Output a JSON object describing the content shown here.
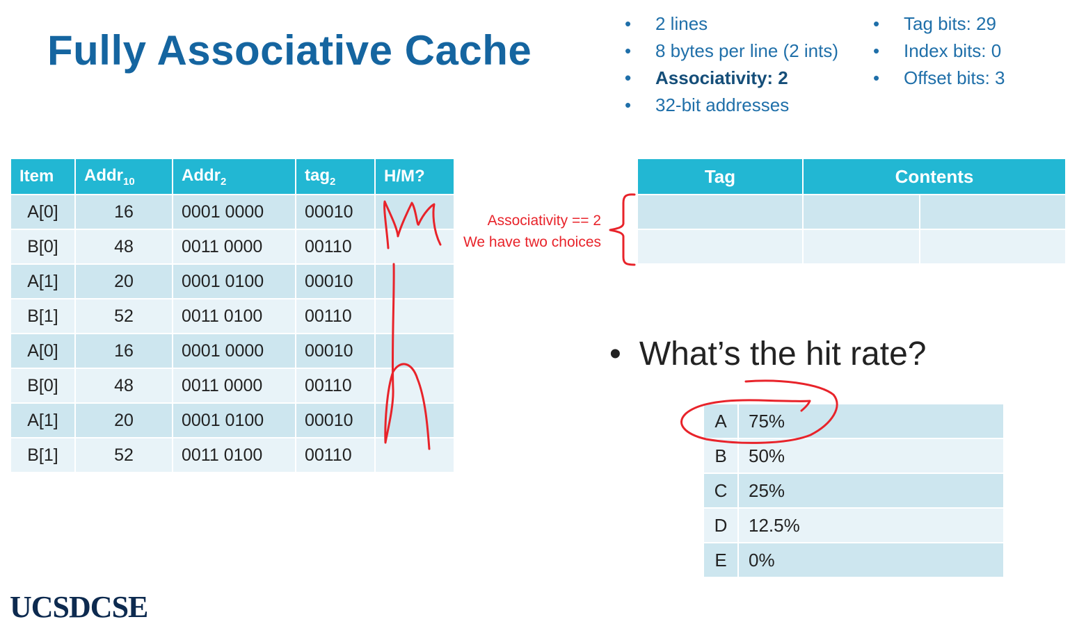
{
  "slide": {
    "title": "Fully Associative Cache",
    "bullets_left": [
      "2 lines",
      "8 bytes per line (2 ints)",
      "Associativity:  2",
      "32-bit addresses"
    ],
    "bullets_right": [
      "Tag bits: 29",
      "Index bits: 0",
      "Offset bits: 3"
    ],
    "accent_color": "#22b7d3",
    "title_color": "#1565a0"
  },
  "access_table": {
    "headers": {
      "item": "Item",
      "addr10": "Addr",
      "addr10_sub": "10",
      "addr2": "Addr",
      "addr2_sub": "2",
      "tag2": "tag",
      "tag2_sub": "2",
      "hm": "H/M?"
    },
    "rows": [
      {
        "item": "A[0]",
        "addr10": "16",
        "addr2": "0001 0000",
        "tag2": "00010",
        "hm": ""
      },
      {
        "item": "B[0]",
        "addr10": "48",
        "addr2": "0011 0000",
        "tag2": "00110",
        "hm": ""
      },
      {
        "item": "A[1]",
        "addr10": "20",
        "addr2": "0001 0100",
        "tag2": "00010",
        "hm": ""
      },
      {
        "item": "B[1]",
        "addr10": "52",
        "addr2": "0011 0100",
        "tag2": "00110",
        "hm": ""
      },
      {
        "item": "A[0]",
        "addr10": "16",
        "addr2": "0001 0000",
        "tag2": "00010",
        "hm": ""
      },
      {
        "item": "B[0]",
        "addr10": "48",
        "addr2": "0011 0000",
        "tag2": "00110",
        "hm": ""
      },
      {
        "item": "A[1]",
        "addr10": "20",
        "addr2": "0001 0100",
        "tag2": "00010",
        "hm": ""
      },
      {
        "item": "B[1]",
        "addr10": "52",
        "addr2": "0011 0100",
        "tag2": "00110",
        "hm": ""
      }
    ]
  },
  "cache_table": {
    "headers": {
      "tag": "Tag",
      "contents": "Contents"
    },
    "rows": [
      {
        "tag": "",
        "contents_a": "",
        "contents_b": ""
      },
      {
        "tag": "",
        "contents_a": "",
        "contents_b": ""
      }
    ]
  },
  "annotation": {
    "line1": "Associativity == 2",
    "line2": "We have two choices",
    "color": "#e8232a"
  },
  "quiz": {
    "question": "What’s the hit rate?",
    "options": [
      {
        "letter": "A",
        "value": "75%"
      },
      {
        "letter": "B",
        "value": "50%"
      },
      {
        "letter": "C",
        "value": "25%"
      },
      {
        "letter": "D",
        "value": "12.5%"
      },
      {
        "letter": "E",
        "value": "0%"
      }
    ],
    "circled_option": "A"
  },
  "logo": {
    "text": "UCSDCSE"
  }
}
